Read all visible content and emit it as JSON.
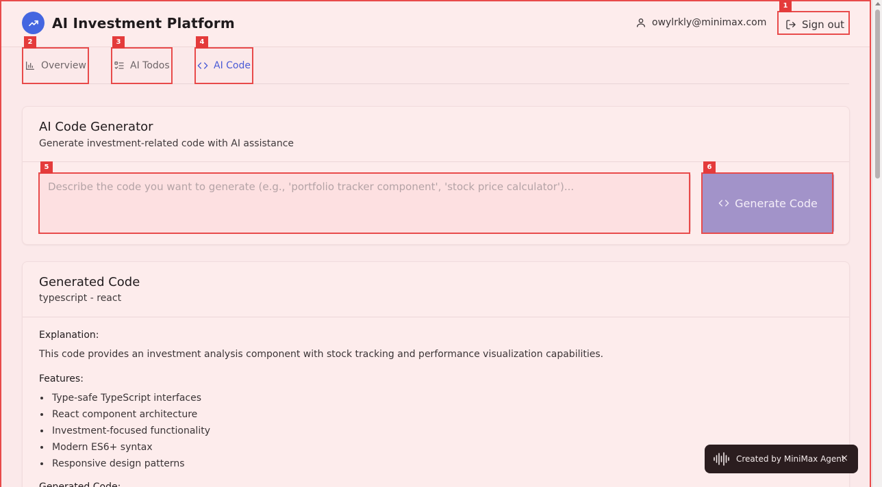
{
  "header": {
    "app_title": "AI Investment Platform",
    "user_email": "owylrkly@minimax.com",
    "sign_out_label": "Sign out"
  },
  "tabs": [
    {
      "label": "Overview",
      "icon": "bar-chart-icon"
    },
    {
      "label": "AI Todos",
      "icon": "list-checks-icon"
    },
    {
      "label": "AI Code",
      "icon": "code-icon",
      "active": true
    }
  ],
  "generator": {
    "title": "AI Code Generator",
    "subtitle": "Generate investment-related code with AI assistance",
    "prompt_placeholder": "Describe the code you want to generate (e.g., 'portfolio tracker component', 'stock price calculator')...",
    "prompt_value": "",
    "button_label": "Generate Code"
  },
  "output": {
    "title": "Generated Code",
    "subtitle": "typescript - react",
    "explanation_label": "Explanation:",
    "explanation": "This code provides an investment analysis component with stock tracking and performance visualization capabilities.",
    "features_label": "Features:",
    "features": [
      "Type-safe TypeScript interfaces",
      "React component architecture",
      "Investment-focused functionality",
      "Modern ES6+ syntax",
      "Responsive design patterns"
    ],
    "code_label": "Generated Code:"
  },
  "badge": {
    "text": "Created by MiniMax Agent",
    "close": "×"
  },
  "markers": [
    "1",
    "2",
    "3",
    "4",
    "5",
    "6"
  ],
  "colors": {
    "accent": "#4a5bd6",
    "brand_logo": "#4466e0",
    "button_bg": "#a293c9",
    "highlight_border": "#e84a4a"
  }
}
